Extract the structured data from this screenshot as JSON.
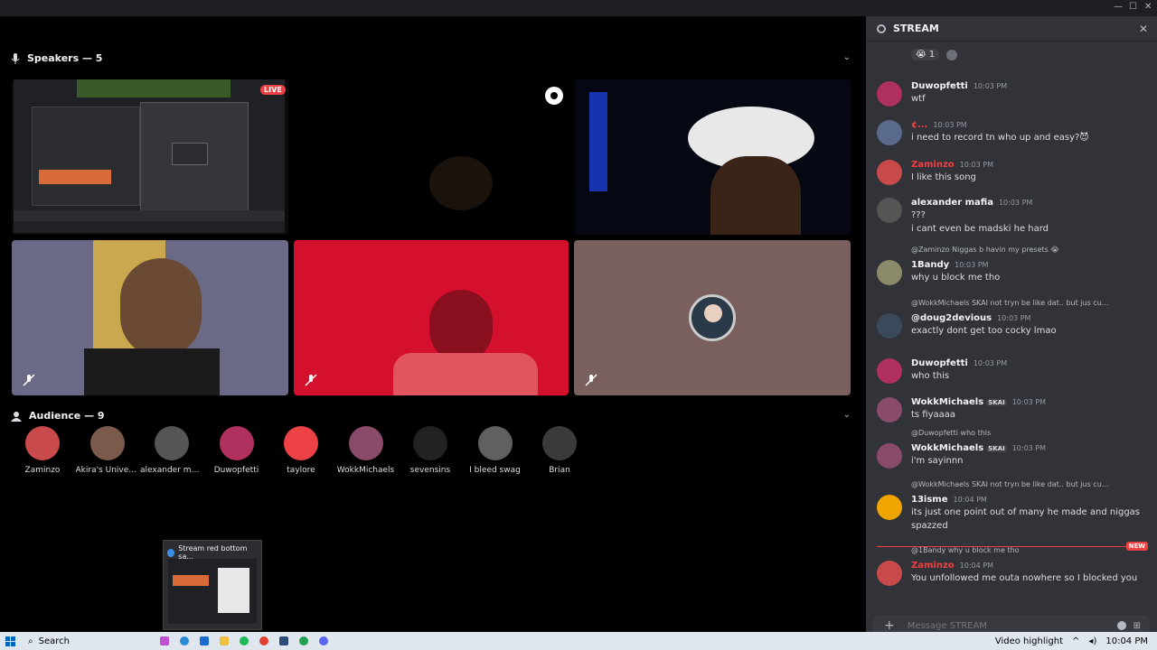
{
  "window": {
    "controls": [
      "—",
      "☐",
      "✕"
    ]
  },
  "speakers": {
    "label": "Speakers — 5",
    "live_badge": "LIVE"
  },
  "audience": {
    "label": "Audience — 9",
    "members": [
      {
        "name": "Zaminzo",
        "color": "#c94a4a"
      },
      {
        "name": "Akira's Univer...",
        "color": "#7a5a4a"
      },
      {
        "name": "alexander ma...",
        "color": "#555555"
      },
      {
        "name": "Duwopfetti",
        "color": "#b03060"
      },
      {
        "name": "taylore",
        "color": "#ed4245"
      },
      {
        "name": "WokkMichaels",
        "color": "#8a4a6a"
      },
      {
        "name": "sevensins",
        "color": "#222222"
      },
      {
        "name": "I bleed swag",
        "color": "#606060"
      },
      {
        "name": "Brian",
        "color": "#3a3a3a"
      }
    ]
  },
  "thumbnail": {
    "title": "Stream red bottom sa..."
  },
  "panel": {
    "title": "STREAM",
    "reaction_emoji": "😭",
    "reaction_count": "1",
    "composer_placeholder": "Message STREAM",
    "new_badge": "NEW",
    "messages": [
      {
        "user": "Duwopfetti",
        "user_color": "#f2f3f5",
        "time": "10:03 PM",
        "text": "wtf",
        "avatar_color": "#b03060"
      },
      {
        "user": "¢...",
        "user_color": "#f23f43",
        "time": "10:03 PM",
        "text": "i need to record tn who up and easy?😈",
        "avatar_color": "#5a6a8a"
      },
      {
        "user": "Zaminzo",
        "user_color": "#f23f43",
        "time": "10:03 PM",
        "text": "I like this song",
        "avatar_color": "#c94a4a"
      },
      {
        "user": "alexander mafia",
        "user_color": "#f2f3f5",
        "time": "10:03 PM",
        "text": "???",
        "text2": "i cant even be madski he hard",
        "avatar_color": "#555555"
      },
      {
        "reply": "@Zaminzo  Niggas b havin my presets 😭",
        "user": "1Bandy",
        "user_color": "#f2f3f5",
        "time": "10:03 PM",
        "text": "why u block me tho",
        "avatar_color": "#8a8a6a"
      },
      {
        "reply": "@WokkMichaels  SKAI  not tryn be like dat.. but jus cu...",
        "user": "@doug2devious",
        "user_color": "#f2f3f5",
        "time": "10:03 PM",
        "text": "exactly dont get too cocky lmao",
        "avatar_color": "#3a4a5a"
      },
      {
        "user": "Duwopfetti",
        "user_color": "#f2f3f5",
        "time": "10:03 PM",
        "text": "who this",
        "avatar_color": "#b03060"
      },
      {
        "user": "WokkMichaels",
        "user_color": "#f2f3f5",
        "tag": "SKAI",
        "time": "10:03 PM",
        "text": "ts fiyaaaa",
        "avatar_color": "#8a4a6a"
      },
      {
        "reply": "@Duwopfetti  who this",
        "user": "WokkMichaels",
        "user_color": "#f2f3f5",
        "tag": "SKAI",
        "time": "10:03 PM",
        "text": "i'm sayinnn",
        "avatar_color": "#8a4a6a"
      },
      {
        "reply": "@WokkMichaels  SKAI  not tryn be like dat.. but jus cu...",
        "user": "13isme",
        "user_color": "#f2f3f5",
        "time": "10:04 PM",
        "text": "its just one point out of many he made and niggas",
        "text2": "spazzed",
        "avatar_color": "#f0a500"
      },
      {
        "reply": "@1Bandy why u block me tho",
        "user": "Zaminzo",
        "user_color": "#f23f43",
        "time": "10:04 PM",
        "text": "You unfollowed me outa nowhere so I blocked you",
        "avatar_color": "#c94a4a"
      }
    ]
  },
  "taskbar": {
    "search_placeholder": "Search",
    "video_highlight": "Video highlight",
    "clock": "10:04 PM"
  }
}
